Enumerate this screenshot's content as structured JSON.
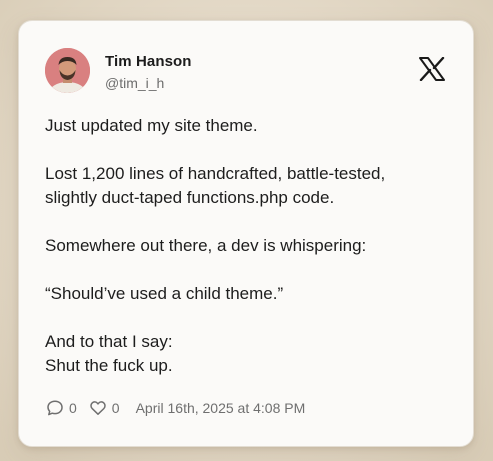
{
  "post": {
    "author_name": "Tim Hanson",
    "author_handle": "@tim_i_h",
    "platform_icon": "x-logo-icon",
    "body": {
      "line1": "Just updated my site theme.",
      "line2": "Lost 1,200 lines of handcrafted, battle-tested,",
      "line3": "slightly duct-taped functions.php code.",
      "line4": "Somewhere out there, a dev is whispering:",
      "line5": "“Should’ve used a child theme.”",
      "line6": "And to that I say:",
      "line7": "Shut the fuck up."
    },
    "stats": {
      "comments": "0",
      "likes": "0"
    },
    "timestamp": "April 16th, 2025 at 4:08 PM"
  },
  "colors": {
    "background": "#e6dccb",
    "card": "#fbfaf8",
    "text": "#1d1d1d",
    "muted": "#6d6d6d",
    "avatar_bg": "#d98080"
  }
}
